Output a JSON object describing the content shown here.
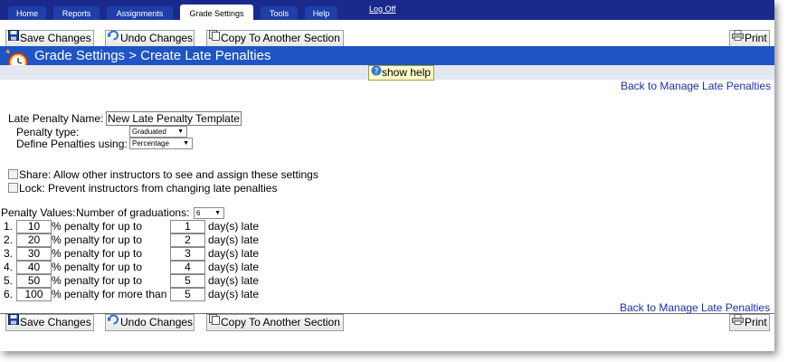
{
  "nav": {
    "tabs": [
      {
        "label": "Home"
      },
      {
        "label": "Reports"
      },
      {
        "label": "Assignments"
      },
      {
        "label": "Grade Settings",
        "active": true
      },
      {
        "label": "Tools"
      },
      {
        "label": "Help"
      }
    ],
    "logoff": "Log Off"
  },
  "toolbar": {
    "save": "Save Changes",
    "undo": "Undo Changes",
    "copy": "Copy To Another Section",
    "print": "Print"
  },
  "page": {
    "title": "Grade Settings > Create Late Penalties",
    "show_help": "show help",
    "back_link": "Back to Manage Late Penalties"
  },
  "form": {
    "name_label": "Late Penalty Name:",
    "name_value": "New Late Penalty Template",
    "type_label": "Penalty type:",
    "type_value": "Graduated",
    "define_label": "Define Penalties using:",
    "define_value": "Percentage",
    "share_label": "Share: Allow other instructors to see and assign these settings",
    "lock_label": "Lock: Prevent instructors from changing late penalties",
    "values_label": "Penalty Values:",
    "grad_label": "Number of graduations:",
    "grad_value": "6",
    "unit": "day(s) late"
  },
  "penalties": [
    {
      "n": "1.",
      "pct": "10",
      "text": "% penalty for up to",
      "days": "1"
    },
    {
      "n": "2.",
      "pct": "20",
      "text": "% penalty for up to",
      "days": "2"
    },
    {
      "n": "3.",
      "pct": "30",
      "text": "% penalty for up to",
      "days": "3"
    },
    {
      "n": "4.",
      "pct": "40",
      "text": "% penalty for up to",
      "days": "4"
    },
    {
      "n": "5.",
      "pct": "50",
      "text": "% penalty for up to",
      "days": "5"
    },
    {
      "n": "6.",
      "pct": "100",
      "text": "% penalty for more than",
      "days": "5"
    }
  ],
  "colors": {
    "navbar": "#1a2a8c",
    "titlebar": "#1f54c4",
    "link": "#1c2fa8"
  }
}
